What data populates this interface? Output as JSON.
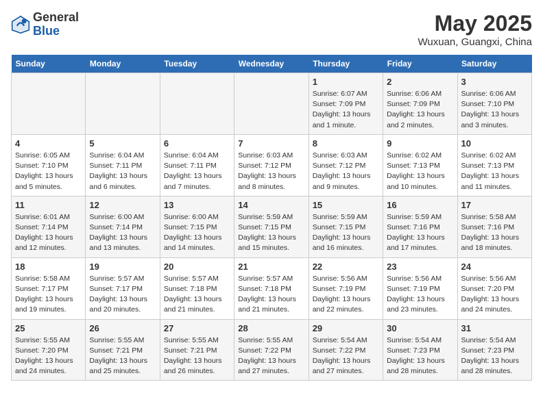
{
  "header": {
    "logo_general": "General",
    "logo_blue": "Blue",
    "month_year": "May 2025",
    "location": "Wuxuan, Guangxi, China"
  },
  "weekdays": [
    "Sunday",
    "Monday",
    "Tuesday",
    "Wednesday",
    "Thursday",
    "Friday",
    "Saturday"
  ],
  "weeks": [
    [
      {
        "day": "",
        "info": ""
      },
      {
        "day": "",
        "info": ""
      },
      {
        "day": "",
        "info": ""
      },
      {
        "day": "",
        "info": ""
      },
      {
        "day": "1",
        "info": "Sunrise: 6:07 AM\nSunset: 7:09 PM\nDaylight: 13 hours and 1 minute."
      },
      {
        "day": "2",
        "info": "Sunrise: 6:06 AM\nSunset: 7:09 PM\nDaylight: 13 hours and 2 minutes."
      },
      {
        "day": "3",
        "info": "Sunrise: 6:06 AM\nSunset: 7:10 PM\nDaylight: 13 hours and 3 minutes."
      }
    ],
    [
      {
        "day": "4",
        "info": "Sunrise: 6:05 AM\nSunset: 7:10 PM\nDaylight: 13 hours and 5 minutes."
      },
      {
        "day": "5",
        "info": "Sunrise: 6:04 AM\nSunset: 7:11 PM\nDaylight: 13 hours and 6 minutes."
      },
      {
        "day": "6",
        "info": "Sunrise: 6:04 AM\nSunset: 7:11 PM\nDaylight: 13 hours and 7 minutes."
      },
      {
        "day": "7",
        "info": "Sunrise: 6:03 AM\nSunset: 7:12 PM\nDaylight: 13 hours and 8 minutes."
      },
      {
        "day": "8",
        "info": "Sunrise: 6:03 AM\nSunset: 7:12 PM\nDaylight: 13 hours and 9 minutes."
      },
      {
        "day": "9",
        "info": "Sunrise: 6:02 AM\nSunset: 7:13 PM\nDaylight: 13 hours and 10 minutes."
      },
      {
        "day": "10",
        "info": "Sunrise: 6:02 AM\nSunset: 7:13 PM\nDaylight: 13 hours and 11 minutes."
      }
    ],
    [
      {
        "day": "11",
        "info": "Sunrise: 6:01 AM\nSunset: 7:14 PM\nDaylight: 13 hours and 12 minutes."
      },
      {
        "day": "12",
        "info": "Sunrise: 6:00 AM\nSunset: 7:14 PM\nDaylight: 13 hours and 13 minutes."
      },
      {
        "day": "13",
        "info": "Sunrise: 6:00 AM\nSunset: 7:15 PM\nDaylight: 13 hours and 14 minutes."
      },
      {
        "day": "14",
        "info": "Sunrise: 5:59 AM\nSunset: 7:15 PM\nDaylight: 13 hours and 15 minutes."
      },
      {
        "day": "15",
        "info": "Sunrise: 5:59 AM\nSunset: 7:15 PM\nDaylight: 13 hours and 16 minutes."
      },
      {
        "day": "16",
        "info": "Sunrise: 5:59 AM\nSunset: 7:16 PM\nDaylight: 13 hours and 17 minutes."
      },
      {
        "day": "17",
        "info": "Sunrise: 5:58 AM\nSunset: 7:16 PM\nDaylight: 13 hours and 18 minutes."
      }
    ],
    [
      {
        "day": "18",
        "info": "Sunrise: 5:58 AM\nSunset: 7:17 PM\nDaylight: 13 hours and 19 minutes."
      },
      {
        "day": "19",
        "info": "Sunrise: 5:57 AM\nSunset: 7:17 PM\nDaylight: 13 hours and 20 minutes."
      },
      {
        "day": "20",
        "info": "Sunrise: 5:57 AM\nSunset: 7:18 PM\nDaylight: 13 hours and 21 minutes."
      },
      {
        "day": "21",
        "info": "Sunrise: 5:57 AM\nSunset: 7:18 PM\nDaylight: 13 hours and 21 minutes."
      },
      {
        "day": "22",
        "info": "Sunrise: 5:56 AM\nSunset: 7:19 PM\nDaylight: 13 hours and 22 minutes."
      },
      {
        "day": "23",
        "info": "Sunrise: 5:56 AM\nSunset: 7:19 PM\nDaylight: 13 hours and 23 minutes."
      },
      {
        "day": "24",
        "info": "Sunrise: 5:56 AM\nSunset: 7:20 PM\nDaylight: 13 hours and 24 minutes."
      }
    ],
    [
      {
        "day": "25",
        "info": "Sunrise: 5:55 AM\nSunset: 7:20 PM\nDaylight: 13 hours and 24 minutes."
      },
      {
        "day": "26",
        "info": "Sunrise: 5:55 AM\nSunset: 7:21 PM\nDaylight: 13 hours and 25 minutes."
      },
      {
        "day": "27",
        "info": "Sunrise: 5:55 AM\nSunset: 7:21 PM\nDaylight: 13 hours and 26 minutes."
      },
      {
        "day": "28",
        "info": "Sunrise: 5:55 AM\nSunset: 7:22 PM\nDaylight: 13 hours and 27 minutes."
      },
      {
        "day": "29",
        "info": "Sunrise: 5:54 AM\nSunset: 7:22 PM\nDaylight: 13 hours and 27 minutes."
      },
      {
        "day": "30",
        "info": "Sunrise: 5:54 AM\nSunset: 7:23 PM\nDaylight: 13 hours and 28 minutes."
      },
      {
        "day": "31",
        "info": "Sunrise: 5:54 AM\nSunset: 7:23 PM\nDaylight: 13 hours and 28 minutes."
      }
    ]
  ]
}
